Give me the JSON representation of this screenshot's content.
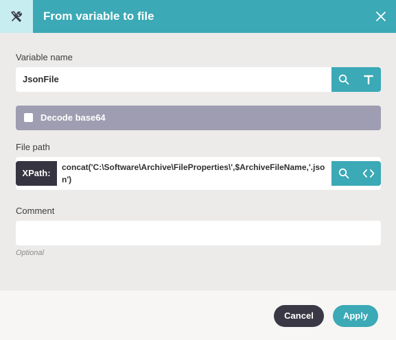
{
  "dialog": {
    "title": "From variable to file",
    "header_icon": "tools-icon",
    "close_icon": "close-icon"
  },
  "variable_name": {
    "label": "Variable name",
    "value": "JsonFile",
    "buttons": [
      "search-icon",
      "text-type-icon"
    ]
  },
  "decode": {
    "label": "Decode base64",
    "checked": false
  },
  "file_path": {
    "label": "File path",
    "prefix": "XPath:",
    "value": "concat('C:\\Software\\Archive\\FileProperties\\',$ArchiveFileName,'.json')",
    "buttons": [
      "search-icon",
      "code-icon"
    ]
  },
  "comment": {
    "label": "Comment",
    "value": "",
    "hint": "Optional"
  },
  "footer": {
    "cancel_label": "Cancel",
    "apply_label": "Apply"
  },
  "colors": {
    "accent": "#3ba9b6",
    "header_icon_bg": "#c8edf1",
    "checkbox_bar": "#9f9db1",
    "dark": "#363440"
  }
}
